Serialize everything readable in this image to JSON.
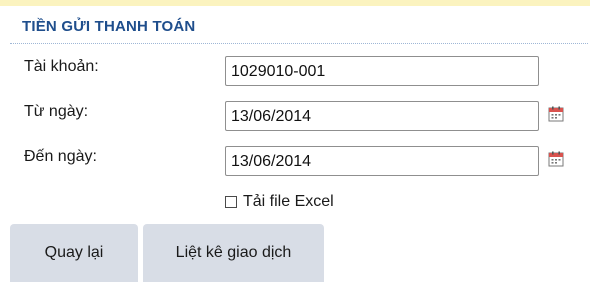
{
  "section": {
    "title": "TIỀN GỬI THANH TOÁN"
  },
  "form": {
    "account": {
      "label": "Tài khoản:",
      "value": "1029010-001"
    },
    "from_date": {
      "label": "Từ ngày:",
      "value": "13/06/2014",
      "icon": "calendar-icon"
    },
    "to_date": {
      "label": "Đến ngày:",
      "value": "13/06/2014",
      "icon": "calendar-icon"
    },
    "excel": {
      "label": "Tải file Excel",
      "checked": false
    }
  },
  "buttons": {
    "back_label": "Quay lại",
    "list_label": "Liệt kê giao dịch"
  },
  "colors": {
    "title": "#1f4e8c",
    "top_strip": "#fbf3bf",
    "button_bg": "#d8dde6"
  }
}
